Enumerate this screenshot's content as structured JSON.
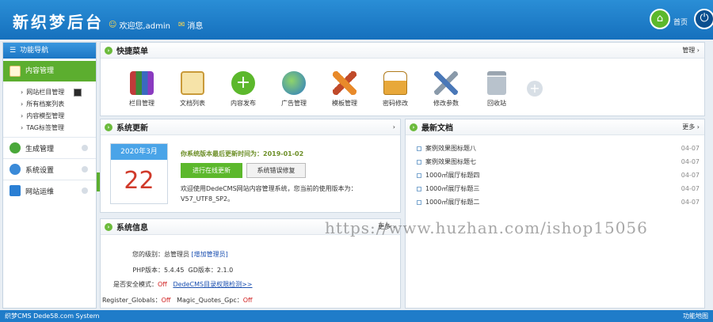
{
  "header": {
    "logo": "新织梦后台",
    "welcome": "欢迎您,admin",
    "messages": "消息",
    "home": "首页"
  },
  "sidebar": {
    "title": "功能导航",
    "active": "内容管理",
    "sub_items": [
      "网站栏目管理",
      "所有档案列表",
      "内容模型管理",
      "TAG标签管理"
    ],
    "items": [
      "生成管理",
      "系统设置",
      "网站运维"
    ]
  },
  "quick_menu": {
    "title": "快捷菜单",
    "manage": "管理",
    "items": [
      {
        "label": "栏目管理",
        "icon": "books-icon"
      },
      {
        "label": "文档列表",
        "icon": "notepad-icon"
      },
      {
        "label": "内容发布",
        "icon": "add-icon"
      },
      {
        "label": "广告管理",
        "icon": "globe-icon"
      },
      {
        "label": "模板管理",
        "icon": "pencil-ruler-icon"
      },
      {
        "label": "密码修改",
        "icon": "lock-icon"
      },
      {
        "label": "修改参数",
        "icon": "tools-icon"
      },
      {
        "label": "回收站",
        "icon": "trash-icon"
      }
    ]
  },
  "update": {
    "title": "系统更新",
    "cal_month": "2020年3月",
    "cal_day": "22",
    "version_note": "你系统版本最后更新时间为：2019-01-02",
    "btn_update": "进行在线更新",
    "btn_repair": "系统错误修复",
    "intro": "欢迎使用DedeCMS网站内容管理系统，您当前的使用版本为：V57_UTF8_SP2。"
  },
  "latest": {
    "title": "最新文档",
    "more": "更多",
    "items": [
      {
        "title": "案例效果图标题八",
        "date": "04-07"
      },
      {
        "title": "案例效果图标题七",
        "date": "04-07"
      },
      {
        "title": "1000㎡展厅标题四",
        "date": "04-07"
      },
      {
        "title": "1000㎡展厅标题三",
        "date": "04-07"
      },
      {
        "title": "1000㎡展厅标题二",
        "date": "04-07"
      }
    ]
  },
  "sysinfo": {
    "title": "系统信息",
    "more": "更多",
    "level_label": "您的级别：",
    "level_value": "总管理员",
    "level_link": "[增加管理员]",
    "php_label": "PHP版本：",
    "php_value": "5.4.45",
    "gd_label": "GD版本：",
    "gd_value": "2.1.0",
    "safe_label": "是否安全模式：",
    "safe_value": "Off",
    "safe_link": "DedeCMS目录权限检测>>",
    "rg_label": "Register_Globals：",
    "rg_value": "Off",
    "mq_label": "Magic_Quotes_Gpc：",
    "mq_value": "Off"
  },
  "footer": {
    "left": "织梦CMS  Dede58.com System",
    "right": "功能地图"
  },
  "watermark": "https://www.huzhan.com/ishop15056",
  "colors": {
    "header": "#1670bd",
    "accent_green": "#5cae2f",
    "red": "#d02020"
  }
}
